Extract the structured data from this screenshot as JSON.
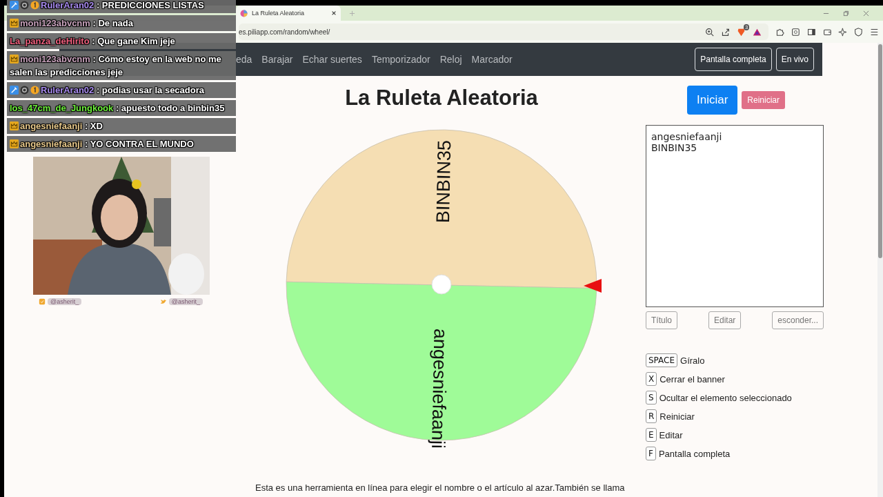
{
  "browser": {
    "tab": {
      "title": "La Ruleta Aleatoria",
      "selected": true
    },
    "address": "es.piliapp.com/random/wheel/",
    "shield_count": "3"
  },
  "nav": {
    "items": [
      "eda",
      "Barajar",
      "Echar suertes",
      "Temporizador",
      "Reloj",
      "Marcador"
    ],
    "buttons": [
      "Pantalla completa",
      "En vivo"
    ]
  },
  "page": {
    "title": "La Ruleta Aleatoria",
    "wheel": {
      "segments": [
        {
          "label": "BINBIN35",
          "color": "#f5deb3"
        },
        {
          "label": "angesniefaanji",
          "color": "#9ffb98"
        }
      ]
    },
    "start_button": "Iniciar",
    "reset_button": "Reiniciar",
    "entries": "angesniefaanji\nBINBIN35",
    "entry_buttons": [
      "Título",
      "Editar",
      "esconder..."
    ],
    "shortcuts": [
      {
        "key": "SPACE",
        "action": "Gíralo"
      },
      {
        "key": "X",
        "action": "Cerrar el banner"
      },
      {
        "key": "S",
        "action": "Ocultar el elemento seleccionado"
      },
      {
        "key": "R",
        "action": "Reiniciar"
      },
      {
        "key": "E",
        "action": "Editar"
      },
      {
        "key": "F",
        "action": "Pantalla completa"
      }
    ],
    "description": "Esta es una herramienta en línea para elegir el nombre o el artículo al azar.También se llama"
  },
  "chat": [
    {
      "badges": [
        {
          "kind": "game"
        },
        {
          "kind": "gear"
        },
        {
          "kind": "coin"
        }
      ],
      "user": "RulerAran02",
      "color": "#a98cf0",
      "text": ": PREDICCIONES LISTAS"
    },
    {
      "badges": [
        {
          "kind": "crown"
        }
      ],
      "user": "moni123abvcnm",
      "color": "#c9a3bd",
      "text": ": De nada"
    },
    {
      "user": "La_panza_deHirito",
      "color": "#f0607e",
      "text": ": Que gane Kim jeje"
    },
    {
      "badges": [
        {
          "kind": "crown"
        }
      ],
      "user": "moni123abvcnm",
      "color": "#c9a3bd",
      "text": ": Cómo estoy en la web no me salen las predicciones jeje"
    },
    {
      "badges": [
        {
          "kind": "game"
        },
        {
          "kind": "gear"
        },
        {
          "kind": "coin"
        }
      ],
      "user": "RulerAran02",
      "color": "#a98cf0",
      "text": ": podias usar la secadora"
    },
    {
      "user": "los_47cm_de_Jungkook",
      "color": "#6ef03c",
      "text": ": apuesto todo a binbin35"
    },
    {
      "badges": [
        {
          "kind": "crown"
        }
      ],
      "user": "angesniefaanji",
      "color": "#e8c98c",
      "text": ": XD"
    },
    {
      "badges": [
        {
          "kind": "crown"
        }
      ],
      "user": "angesniefaanji",
      "color": "#e8c98c",
      "text": ": YO CONTRA EL MUNDO"
    }
  ],
  "webcam": {
    "kind": "picture",
    "handles": [
      {
        "kind": "box",
        "text": "@asherit_"
      },
      {
        "kind": "bird",
        "text": "@asherit_"
      }
    ]
  }
}
